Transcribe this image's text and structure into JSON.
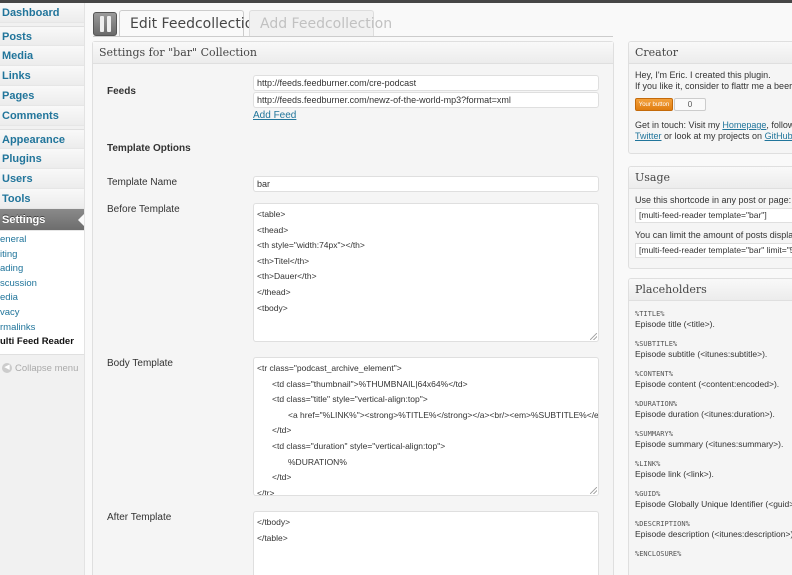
{
  "sidebar": {
    "items": [
      {
        "label": "Dashboard"
      },
      {
        "label": "Posts"
      },
      {
        "label": "Media"
      },
      {
        "label": "Links"
      },
      {
        "label": "Pages"
      },
      {
        "label": "Comments"
      },
      {
        "label": "Appearance"
      },
      {
        "label": "Plugins"
      },
      {
        "label": "Users"
      },
      {
        "label": "Tools"
      },
      {
        "label": "Settings"
      }
    ],
    "submenu": [
      {
        "label": "eneral"
      },
      {
        "label": "iting"
      },
      {
        "label": "ading"
      },
      {
        "label": "scussion"
      },
      {
        "label": "edia"
      },
      {
        "label": "vacy"
      },
      {
        "label": "rmalinks"
      },
      {
        "label": "ulti Feed Reader"
      }
    ],
    "collapse_label": "Collapse menu"
  },
  "tabs": {
    "edit_label": "Edit Feedcollection",
    "add_label": "Add Feedcollection"
  },
  "main": {
    "box_title": "Settings for \"bar\" Collection",
    "feeds_label": "Feeds",
    "feed_urls": [
      "http://feeds.feedburner.com/cre-podcast",
      "http://feeds.feedburner.com/newz-of-the-world-mp3?format=xml"
    ],
    "add_feed_label": "Add Feed",
    "template_options_label": "Template Options",
    "template_name_label": "Template Name",
    "template_name_value": "bar",
    "before_template_label": "Before Template",
    "before_template_lines": [
      "<table>",
      "<thead>",
      "<th style=\"width:74px\"></th>",
      "<th>Titel</th>",
      "<th>Dauer</th>",
      "</thead>",
      "<tbody>"
    ],
    "body_template_label": "Body Template",
    "body_template_lines": [
      "<tr class=\"podcast_archive_element\">",
      "<td class=\"thumbnail\">%THUMBNAIL|64x64%</td>",
      "<td class=\"title\" style=\"vertical-align:top\">",
      "<a href=\"%LINK%\"><strong>%TITLE%</strong></a><br/><em>%SUBTITLE%</em>",
      "</td>",
      "<td class=\"duration\" style=\"vertical-align:top\">",
      "%DURATION%",
      "</td>",
      "</tr>"
    ],
    "after_template_label": "After Template",
    "after_template_lines": [
      "</tbody>",
      "</table>"
    ]
  },
  "creator": {
    "title": "Creator",
    "line1": "Hey, I'm Eric. I created this plugin.",
    "line2": "If you like it, consider to flattr me a beer.",
    "flattr_label": "Your button",
    "flattr_count": "0",
    "contact_prefix": "Get in touch: Visit my ",
    "homepage_link": "Homepage",
    "contact_mid": ", follow me",
    "twitter_link": "Twitter",
    "contact_mid2": " or look at my projects on ",
    "github_link": "GitHub",
    "contact_end": "."
  },
  "usage": {
    "title": "Usage",
    "line1": "Use this shortcode in any post or page:",
    "code1": "[multi-feed-reader template=\"bar\"]",
    "line2": "You can limit the amount of posts displayed",
    "code2": "[multi-feed-reader template=\"bar\" limit=\"5\"]"
  },
  "placeholders": {
    "title": "Placeholders",
    "items": [
      {
        "code": "%TITLE%",
        "desc": "Episode title (<title>)."
      },
      {
        "code": "%SUBTITLE%",
        "desc": "Episode subtitle (<itunes:subtitle>)."
      },
      {
        "code": "%CONTENT%",
        "desc": "Episode content (<content:encoded>)."
      },
      {
        "code": "%DURATION%",
        "desc": "Episode duration (<itunes:duration>)."
      },
      {
        "code": "%SUMMARY%",
        "desc": "Episode summary (<itunes:summary>)."
      },
      {
        "code": "%LINK%",
        "desc": "Episode link (<link>)."
      },
      {
        "code": "%GUID%",
        "desc": "Episode Globally Unique Identifier (<guid>)"
      },
      {
        "code": "%DESCRIPTION%",
        "desc": "Episode description (<itunes:description>)."
      },
      {
        "code": "%ENCLOSURE%",
        "desc": ""
      }
    ]
  }
}
